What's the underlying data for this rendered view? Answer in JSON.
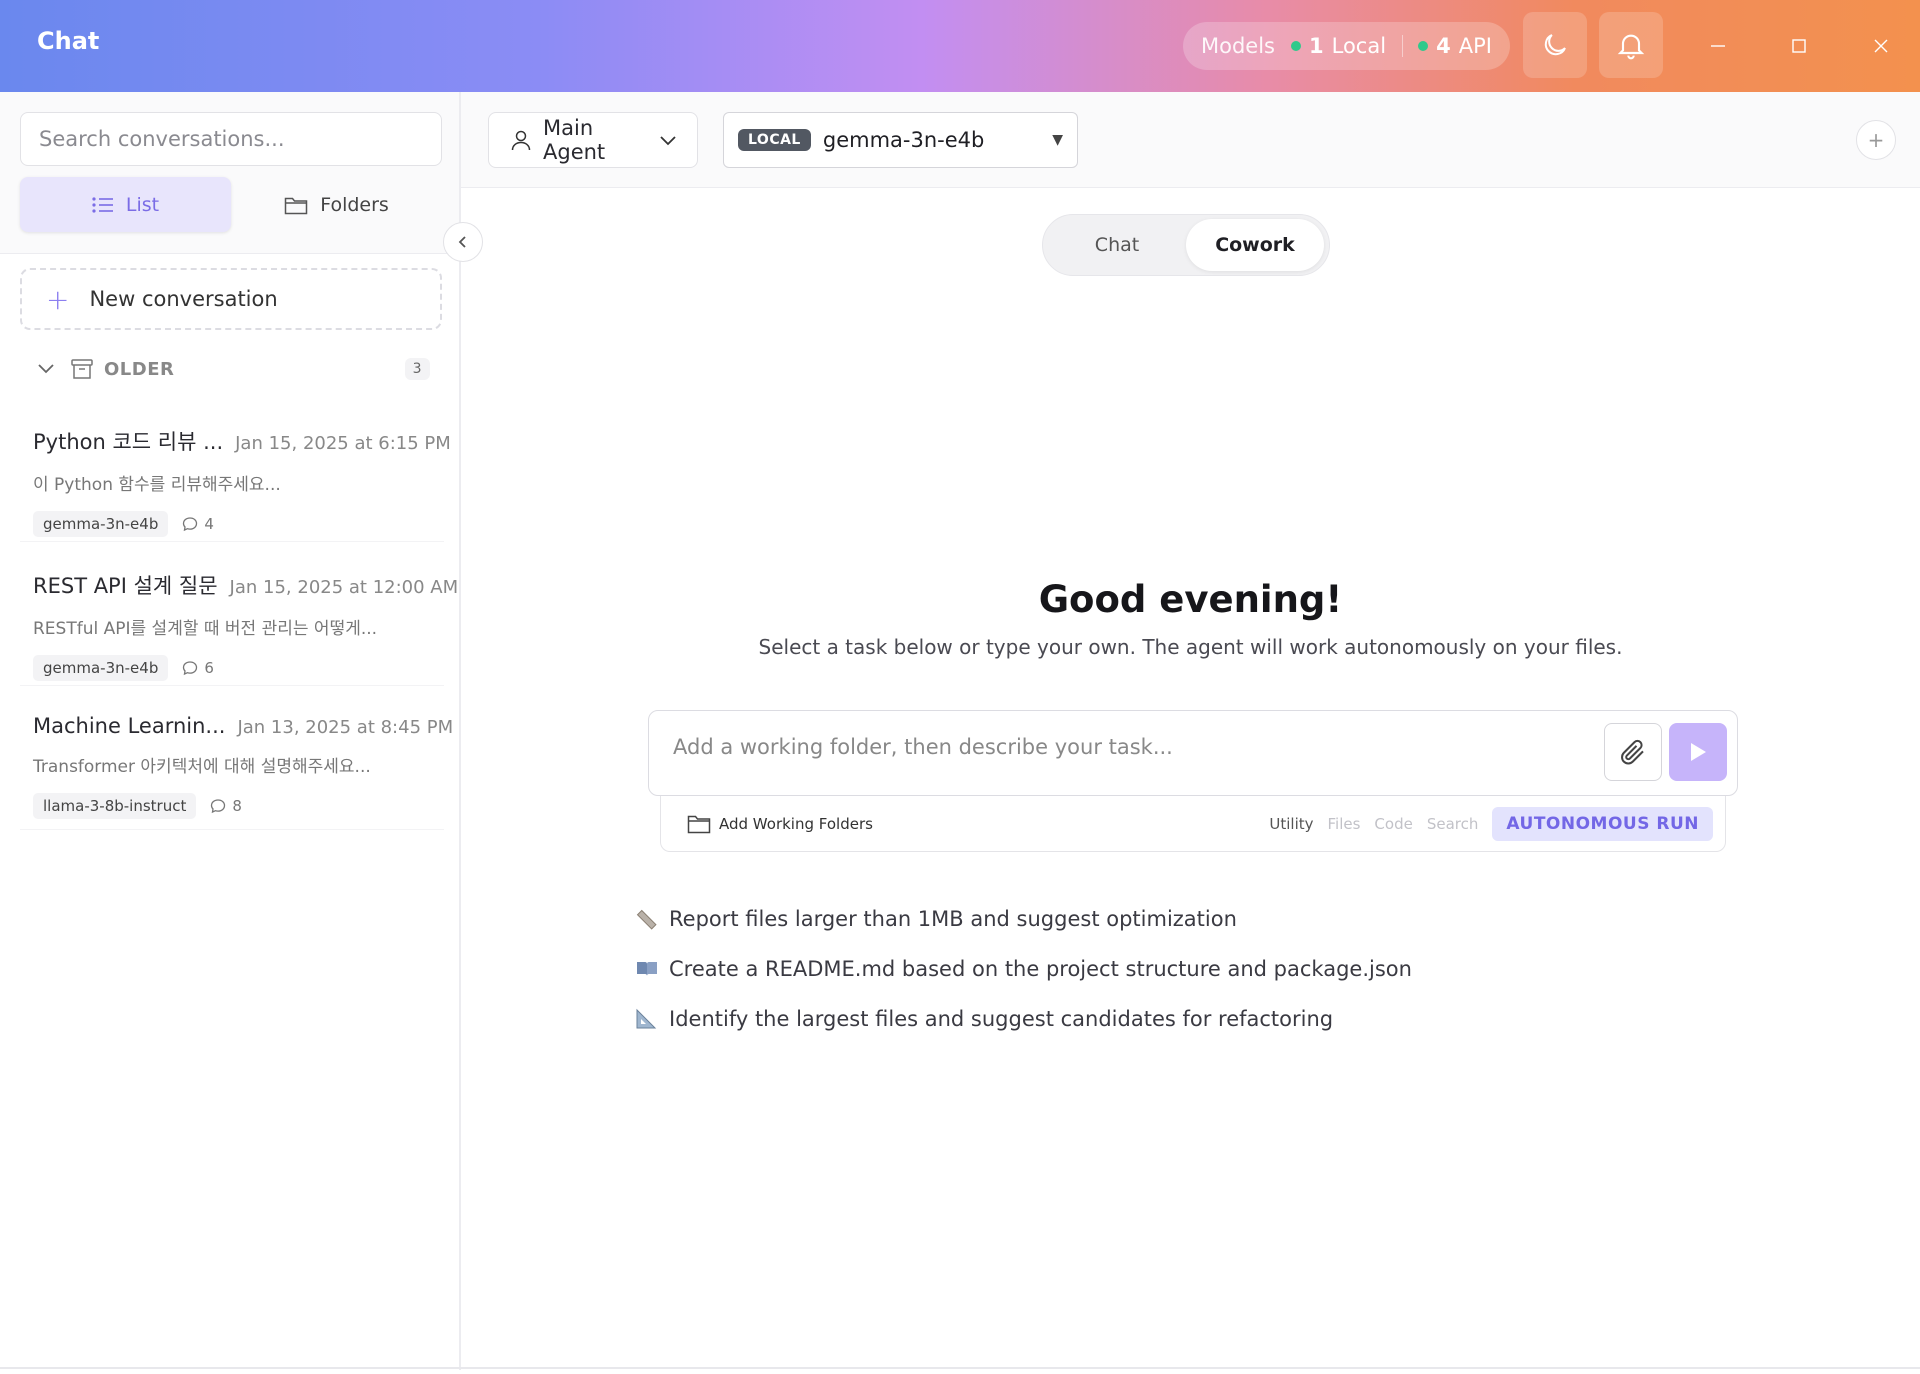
{
  "window": {
    "title": "Chat",
    "models_label": "Models",
    "local_count": "1",
    "local_label": "Local",
    "api_count": "4",
    "api_label": "API"
  },
  "sidebar": {
    "search_placeholder": "Search conversations...",
    "view_list_label": "List",
    "view_folders_label": "Folders",
    "new_conversation_label": "New conversation",
    "group": {
      "label": "OLDER",
      "count": "3"
    },
    "conversations": [
      {
        "title": "Python 코드 리뷰 ...",
        "date": "Jan 15, 2025 at 6:15 PM",
        "preview": "이 Python 함수를 리뷰해주세요...",
        "model": "gemma-3n-e4b",
        "messages": "4"
      },
      {
        "title": "REST API 설계 질문",
        "date": "Jan 15, 2025 at 12:00 AM",
        "preview": "RESTful API를 설계할 때 버전 관리는 어떻게...",
        "model": "gemma-3n-e4b",
        "messages": "6"
      },
      {
        "title": "Machine Learnin...",
        "date": "Jan 13, 2025 at 8:45 PM",
        "preview": "Transformer 아키텍처에 대해 설명해주세요...",
        "model": "llama-3-8b-instruct",
        "messages": "8"
      }
    ]
  },
  "main": {
    "agent_label": "Main Agent",
    "model_badge": "LOCAL",
    "model_name": "gemma-3n-e4b",
    "add_icon": "+",
    "tabs": [
      {
        "label": "Chat"
      },
      {
        "label": "Cowork"
      }
    ],
    "active_tab": "Cowork",
    "greeting": "Good evening!",
    "subtitle": "Select a task below or type your own. The agent will work autonomously on your files.",
    "task_placeholder": "Add a working folder, then describe your task...",
    "add_folders_label": "Add Working Folders",
    "tool_tags": [
      "Utility",
      "Files",
      "Code",
      "Search"
    ],
    "autonomous_label": "AUTONOMOUS RUN",
    "suggestions": [
      {
        "icon": "ruler-icon",
        "text": "Report files larger than 1MB and suggest optimization"
      },
      {
        "icon": "book-icon",
        "text": "Create a README.md based on the project structure and package.json"
      },
      {
        "icon": "triangle-ruler-icon",
        "text": "Identify the largest files and suggest candidates for refactoring"
      }
    ]
  },
  "colors": {
    "accent": "#7b6ce6",
    "status_dot": "#2fc98b",
    "send_button": "#c6b4fa"
  }
}
